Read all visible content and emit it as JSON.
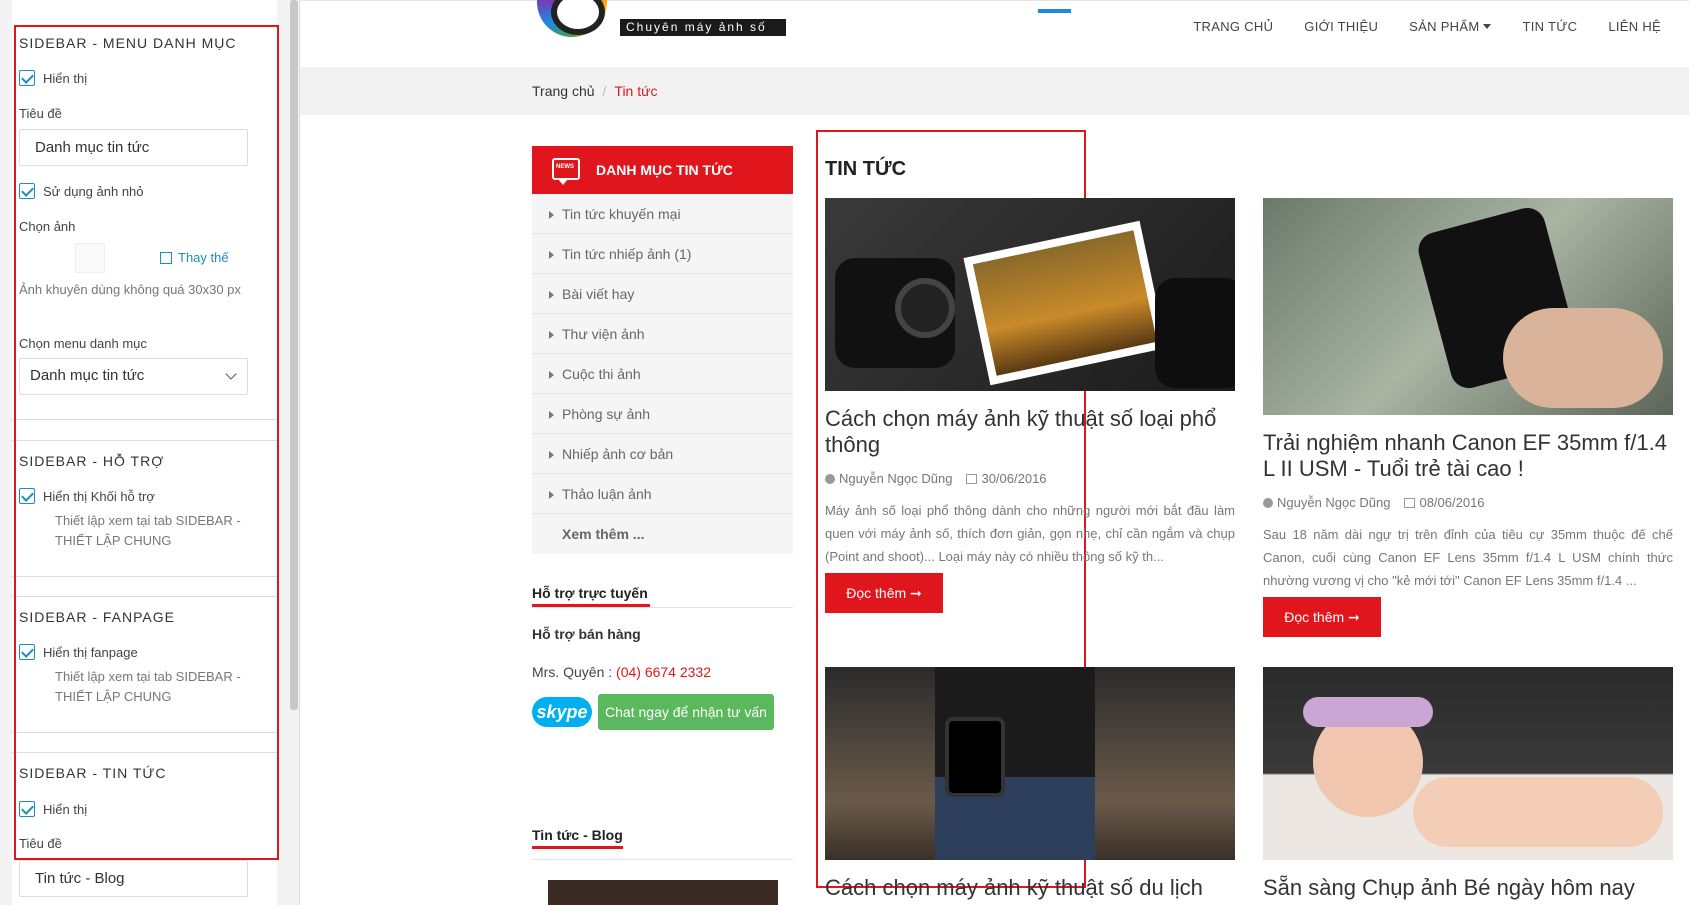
{
  "panel": {
    "menu_section": {
      "title": "SIDEBAR - MENU DANH MỤC",
      "show_label": "Hiển thị",
      "title_label": "Tiêu đề",
      "title_value": "Danh mục tin tức",
      "use_thumb_label": "Sử dụng ảnh nhỏ",
      "choose_image_label": "Chọn ảnh",
      "replace_label": "Thay thế",
      "image_hint": "Ảnh khuyên dùng không quá 30x30 px",
      "choose_menu_label": "Chọn menu danh mục",
      "menu_value": "Danh mục tin tức"
    },
    "support_section": {
      "title": "SIDEBAR - HỖ TRỢ",
      "show_label": "Hiển thị Khối hỗ trợ",
      "hint": "Thiết lập xem tại tab SIDEBAR - THIẾT LẬP CHUNG"
    },
    "fanpage_section": {
      "title": "SIDEBAR - FANPAGE",
      "show_label": "Hiển thị fanpage",
      "hint": "Thiết lập xem tại tab SIDEBAR - THIẾT LẬP CHUNG"
    },
    "news_section": {
      "title": "SIDEBAR - TIN TỨC",
      "show_label": "Hiển thị",
      "title_label": "Tiêu đề",
      "title_value": "Tin tức - Blog"
    }
  },
  "site": {
    "logo_text": "Chuyên máy ảnh số",
    "nav": [
      "TRANG CHỦ",
      "GIỚI THIỆU",
      "SẢN PHẨM",
      "TIN TỨC",
      "LIÊN HỆ"
    ],
    "breadcrumb": {
      "home": "Trang chủ",
      "sep": "/",
      "current": "Tin tức"
    },
    "sidebar": {
      "category_title": "DANH MỤC TIN TỨC",
      "news_icon_text": "NEWS",
      "categories": [
        "Tin tức khuyến mại",
        "Tin tức nhiếp ảnh (1)",
        "Bài viết hay",
        "Thư viện ảnh",
        "Cuộc thi ảnh",
        "Phòng sự ảnh",
        "Nhiếp ảnh cơ bản",
        "Thảo luận ảnh"
      ],
      "more": "Xem thêm ...",
      "support_title": "Hỗ trợ trực tuyến",
      "support_heading": "Hỗ trợ bán hàng",
      "support_name": "Mrs. Quyên :",
      "support_phone": "(04) 6674 2332",
      "skype": "skype",
      "chat_label": "Chat ngay để nhận tư vấn",
      "blog_title": "Tin tức - Blog"
    },
    "content": {
      "title": "TIN TỨC",
      "read_more": "Đọc thêm ➞",
      "posts": [
        {
          "title": "Cách chọn máy ảnh kỹ thuật số loại phổ thông",
          "author": "Nguyễn Ngọc Dũng",
          "date": "30/06/2016",
          "excerpt": "Máy ảnh số loại phổ thông dành cho những người mới bắt đầu làm quen với máy ảnh số, thích đơn giản, gọn nhẹ, chỉ cần ngắm và chụp (Point and shoot)... Loại máy này có nhiều thông số kỹ th..."
        },
        {
          "title": "Trải nghiệm nhanh Canon EF 35mm f/1.4 L II USM - Tuổi trẻ tài cao !",
          "author": "Nguyễn Ngọc Dũng",
          "date": "08/06/2016",
          "excerpt": "Sau 18 năm dài ngự trị trên đỉnh của tiêu cự 35mm thuộc đế chế Canon, cuối cùng Canon EF Lens 35mm f/1.4 L USM chính thức nhường vương vị cho \"kẻ mới tới\" Canon EF Lens 35mm f/1.4 ..."
        },
        {
          "title": "Cách chọn máy ảnh kỹ thuật số du lịch"
        },
        {
          "title": "Sẵn sàng Chụp ảnh Bé ngày hôm nay"
        }
      ]
    }
  }
}
